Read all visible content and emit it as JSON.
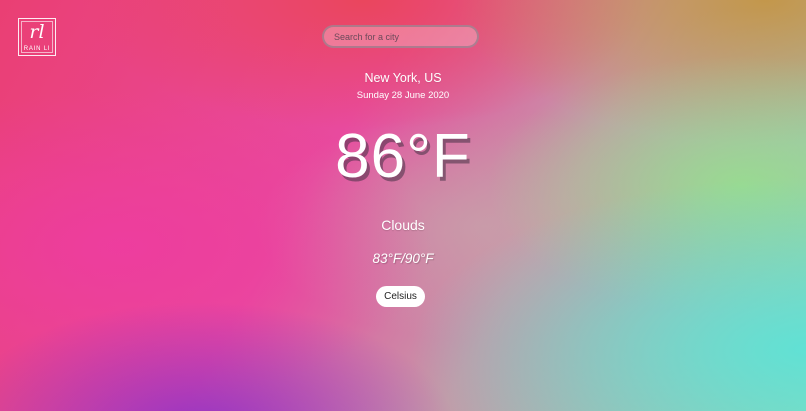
{
  "logo": {
    "mark": "rl",
    "name": "RAIN LI"
  },
  "search": {
    "placeholder": "Search for a city"
  },
  "weather": {
    "location": "New York, US",
    "date": "Sunday 28 June 2020",
    "temperature": "86°F",
    "condition": "Clouds",
    "range": "83°F/90°F"
  },
  "unit_toggle": {
    "label": "Celsius"
  },
  "colors": {
    "text": "#ffffff",
    "button_bg": "#ffffff",
    "button_text": "#222222"
  }
}
